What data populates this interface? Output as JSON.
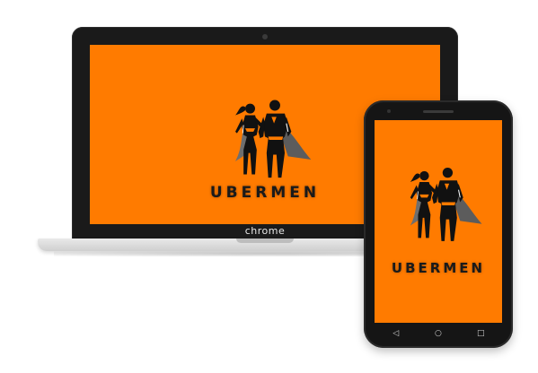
{
  "laptop": {
    "brand_label": "chrome",
    "screen_color": "#ff7b00"
  },
  "phone": {
    "screen_color": "#ff7b00",
    "nav": {
      "back_icon": "◁",
      "home_icon": "○",
      "recents_icon": "□"
    }
  },
  "logo": {
    "text": "UBERMEN",
    "icon_name": "superheroes-icon"
  },
  "colors": {
    "accent": "#ff7b00",
    "figure": "#111111",
    "cape": "#6e6e6e",
    "highlight": "#ffffff"
  }
}
